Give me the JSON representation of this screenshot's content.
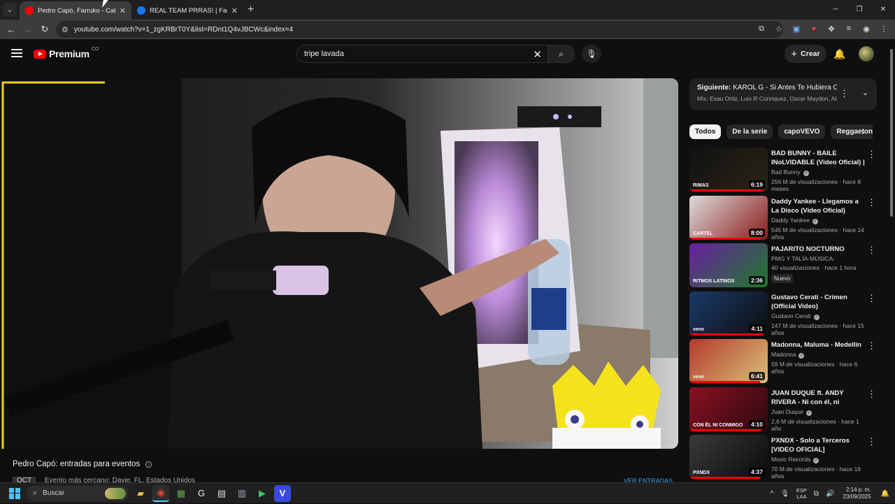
{
  "browser": {
    "tabs": [
      {
        "title": "Pedro Capó, Farruko - Calma (R",
        "favicon_color": "#ff0000",
        "active": true
      },
      {
        "title": "REAL TEAM PRRAS! | Facebook",
        "favicon_color": "#1877f2",
        "active": false
      }
    ],
    "url": "youtube.com/watch?v=1_zgKRBrT0Y&list=RDnt1Q4vJBCWc&index=4"
  },
  "masthead": {
    "brand": "Premium",
    "country": "CO",
    "search_value": "tripe lavada",
    "create_label": "Crear"
  },
  "below_video": {
    "title": "Pedro Capó: entradas para eventos",
    "event_tag": "OCT",
    "event_text": "Evento más cercano: Davie, FL, Estados Unidos",
    "more_link": "VER ENTRADAS"
  },
  "playlist": {
    "next_label": "Siguiente:",
    "next_title": "KAROL G - Si Antes Te Hubiera Co...",
    "mix": "Mix: Esau Ortiz, Luis R Conriquez, Oscar Maydon, Ale..."
  },
  "chips": [
    "Todos",
    "De la serie",
    "capoVEVO",
    "Reggaeton"
  ],
  "recommendations": [
    {
      "title": "BAD BUNNY - BAILE INoLVIDABLE (Video Oficial) | ...",
      "channel": "Bad Bunny",
      "verified": true,
      "stats": "256 M de visualizaciones · hace 8 meses",
      "duration": "6:19",
      "progress": 0.95,
      "thumb": [
        "#111111",
        "#2a2418"
      ],
      "thumb_label": "RIMAS"
    },
    {
      "title": "Daddy Yankee - Llegamos a La Disco (Video Oficial)",
      "channel": "Daddy Yankee",
      "verified": true,
      "stats": "545 M de visualizaciones · hace 14 años",
      "duration": "8:00",
      "progress": 0.9,
      "thumb": [
        "#dcdcdc",
        "#8a1a1a"
      ],
      "thumb_label": "CARTEL"
    },
    {
      "title": "PAJARITO NOCTURNO",
      "channel": "PMG Y TALÍA-MÚSICA-",
      "verified": false,
      "stats": "40 visualizaciones · hace 1 hora",
      "badge": "Nuevo",
      "duration": "2:36",
      "progress": 0.0,
      "thumb": [
        "#6a1fa0",
        "#1f7a2a"
      ],
      "thumb_label": "RITMOS LATINOS"
    },
    {
      "title": "Gustavo Cerati - Crimen (Official Video)",
      "channel": "Gustavo Cerati",
      "verified": true,
      "stats": "147 M de visualizaciones · hace 15 años",
      "duration": "4:11",
      "progress": 0.95,
      "thumb": [
        "#1a3a6a",
        "#0e0e0e"
      ],
      "thumb_label": "vevo"
    },
    {
      "title": "Madonna, Maluma - Medellín",
      "channel": "Madonna",
      "verified": true,
      "stats": "59 M de visualizaciones · hace 6 años",
      "duration": "6:41",
      "progress": 0.9,
      "thumb": [
        "#b43a2a",
        "#d9c07a"
      ],
      "thumb_label": "vevo"
    },
    {
      "title": "JUAN DUQUE ft. ANDY RIVERA - Ni con él, ni conmigo | Video ...",
      "channel": "Juan Duque",
      "verified": true,
      "stats": "2,6 M de visualizaciones · hace 1 año",
      "duration": "4:10",
      "progress": 0.92,
      "thumb": [
        "#8a1020",
        "#2a0a10"
      ],
      "thumb_label": "CON ÉL NI CONMIGO"
    },
    {
      "title": "PXNDX - Solo a Terceros [VIDEO OFICIAL]",
      "channel": "Movic Records",
      "verified": true,
      "stats": "70 M de visualizaciones · hace 16 años",
      "duration": "4:37",
      "progress": 0.9,
      "thumb": [
        "#3a3a3a",
        "#0a0a0a"
      ],
      "thumb_label": "PXNDX"
    }
  ],
  "taskbar": {
    "search_placeholder": "Buscar",
    "lang_top": "ESP",
    "lang_bottom": "LAA",
    "time": "2:14 p. m.",
    "date": "23/09/2025"
  },
  "colors": {
    "accent_red": "#ff0000",
    "link_blue": "#3ea6ff"
  }
}
